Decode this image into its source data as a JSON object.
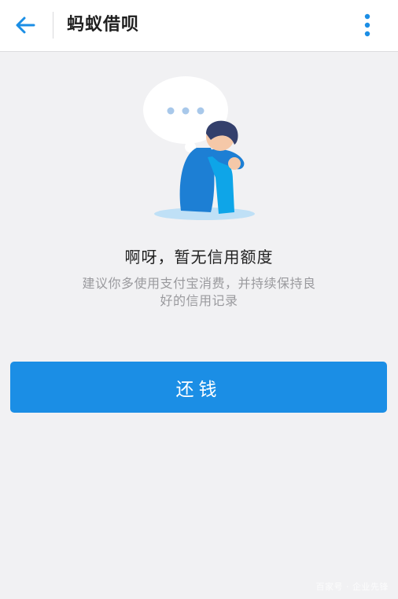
{
  "header": {
    "title": "蚂蚁借呗",
    "back_icon": "arrow-left-icon",
    "more_icon": "more-vertical-icon"
  },
  "empty_state": {
    "illustration_icon": "sad-person-thought-bubble-icon",
    "title": "啊呀，暂无信用额度",
    "description": "建议你多使用支付宝消费，并持续保持良好的信用记录"
  },
  "actions": {
    "repay_label": "还钱"
  },
  "watermark": {
    "text": "百家号 · 企业先锋"
  },
  "colors": {
    "accent": "#1b8ee5",
    "background": "#f1f1f3",
    "header_bg": "#ffffff"
  }
}
